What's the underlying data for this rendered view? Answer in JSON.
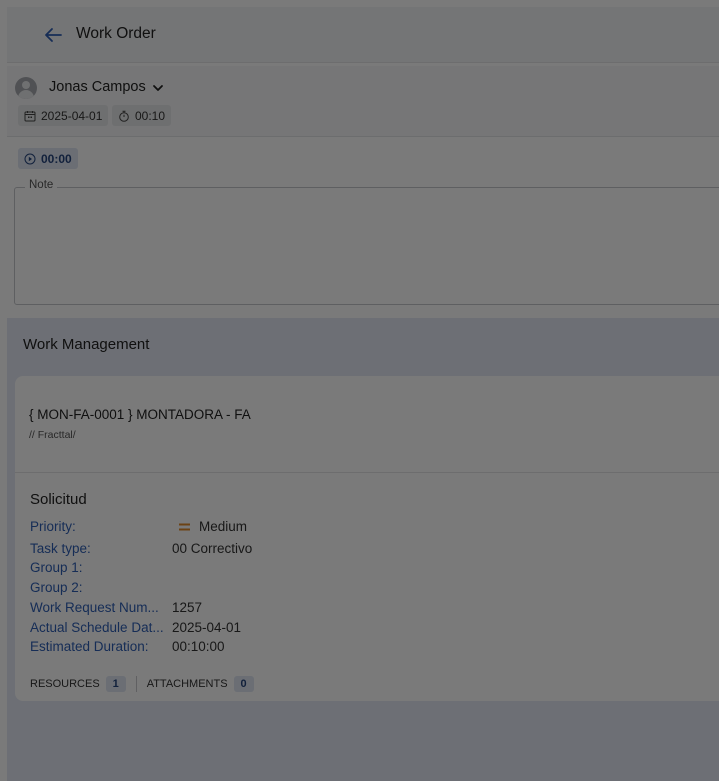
{
  "header": {
    "title": "Work Order",
    "back_icon": "arrow-left-icon"
  },
  "summary": {
    "user_name": "Jonas Campos",
    "date": "2025-04-01",
    "duration": "00:10"
  },
  "timer": {
    "value": "00:00"
  },
  "note": {
    "label": "Note",
    "value": ""
  },
  "work_management": {
    "title": "Work Management",
    "asset": {
      "title": "{ MON-FA-0001 } MONTADORA - FA",
      "path": "// Fracttal/"
    },
    "section_title": "Solicitud",
    "fields": {
      "priority": {
        "label": "Priority:",
        "value": "Medium"
      },
      "task_type": {
        "label": "Task type:",
        "value": "00 Correctivo"
      },
      "group1": {
        "label": "Group 1:",
        "value": ""
      },
      "group2": {
        "label": "Group 2:",
        "value": ""
      },
      "work_request": {
        "label": "Work Request Num...",
        "value": "1257"
      },
      "actual_schedule": {
        "label": "Actual Schedule Dat...",
        "value": "2025-04-01"
      },
      "estimated_duration": {
        "label": "Estimated Duration:",
        "value": "00:10:00"
      }
    },
    "footer": {
      "resources_label": "RESOURCES",
      "resources_count": "1",
      "attachments_label": "ATTACHMENTS",
      "attachments_count": "0"
    }
  },
  "colors": {
    "accent": "#2f5fb5",
    "priority_medium": "#e28a2b",
    "overlay": "rgba(0,0,0,0.52)"
  }
}
